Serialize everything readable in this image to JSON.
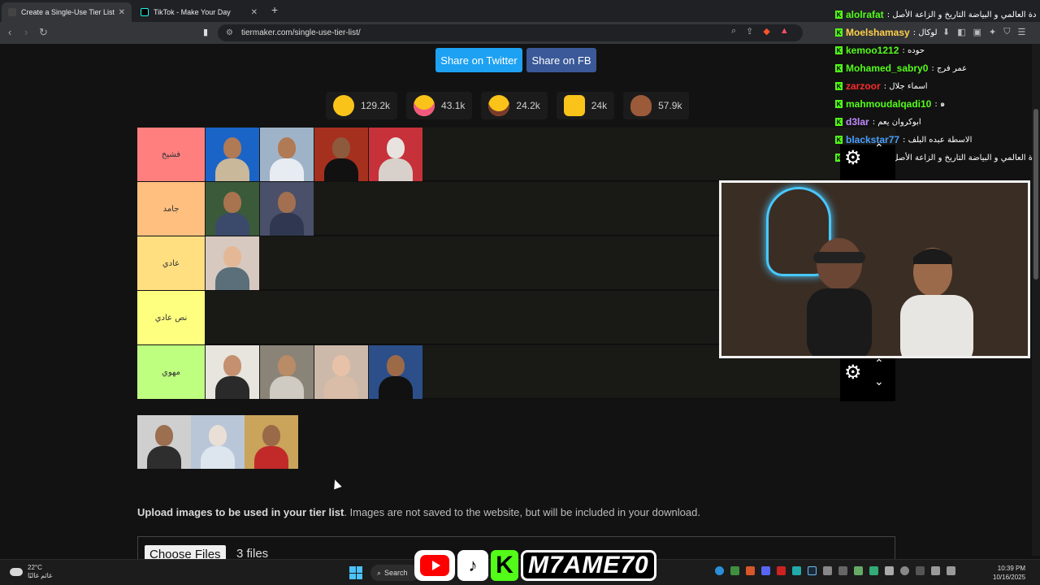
{
  "browser": {
    "tabs": [
      {
        "title": "Create a Single-Use Tier List (Pri",
        "active": true
      },
      {
        "title": "TikTok - Make Your Day",
        "active": false
      }
    ],
    "url": "tiermaker.com/single-use-tier-list/"
  },
  "share": {
    "twitter": "Share on Twitter",
    "fb": "Share on FB"
  },
  "reactions": [
    {
      "icon": "grin-emoji",
      "count": "129.2k",
      "color": "#f9c31a"
    },
    {
      "icon": "heart-eyes-emoji",
      "count": "43.1k",
      "color": "#f9c31a"
    },
    {
      "icon": "laughing-emoji",
      "count": "24.2k",
      "color": "#f9c31a"
    },
    {
      "icon": "raised-hands-emoji",
      "count": "24k",
      "color": "#f9c31a"
    },
    {
      "icon": "poop-emoji",
      "count": "57.9k",
      "color": "#9b5b3a"
    }
  ],
  "tiers": [
    {
      "label": "فشيخ",
      "color": "#ff7f7f",
      "items": 4
    },
    {
      "label": "جامد",
      "color": "#ffbf7f",
      "items": 2
    },
    {
      "label": "عادي",
      "color": "#ffdf7f",
      "items": 1
    },
    {
      "label": "نص عادي",
      "color": "#ffff7f",
      "items": 0
    },
    {
      "label": "مهوي",
      "color": "#bfff7f",
      "items": 4
    }
  ],
  "pool_items": 3,
  "upload": {
    "bold": "Upload images to be used in your tier list",
    "rest": ". Images are not saved to the website, but will be included in your download.",
    "button": "Choose Files",
    "status": "3 files"
  },
  "chat": [
    {
      "user": "alolrafat",
      "color": "#53fc18",
      "msg": ": دة العالمي و البياضة التاريخ و الزاعة الأصل"
    },
    {
      "user": "Moelshamasy",
      "color": "#ffd04a",
      "msg": ": لوكال"
    },
    {
      "user": "kemoo1212",
      "color": "#53fc18",
      "msg": ": حوده"
    },
    {
      "user": "Mohamed_sabry0",
      "color": "#53fc18",
      "msg": ": عمر فرج"
    },
    {
      "user": "zarzoor",
      "color": "#ff2a2a",
      "msg": ": اسماء جلال"
    },
    {
      "user": "mahmoudalqadi10",
      "color": "#53fc18",
      "msg": ": ๑"
    },
    {
      "user": "d3lar",
      "color": "#c28bff",
      "msg": ": ابوكروان يعم"
    },
    {
      "user": "blackstar77",
      "color": "#4a9dff",
      "msg": ": الاسطة عبده البلف"
    },
    {
      "user": "alolrafat",
      "color": "#53fc18",
      "msg": ": دة العالمي و البياضة التاريخ و الزاعة الأصل"
    }
  ],
  "taskbar": {
    "temp": "22°C",
    "weather_sub": "غائم غالبًا",
    "search": "Search",
    "brand_name": "M7AME70",
    "time": "10:39 PM",
    "date": "10/16/2025"
  }
}
